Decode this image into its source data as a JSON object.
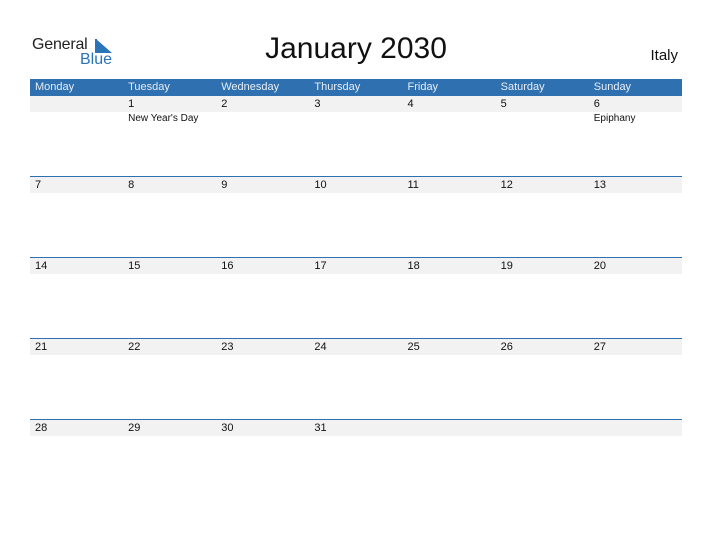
{
  "logo": {
    "text_general": "General",
    "text_blue": "Blue"
  },
  "title": "January 2030",
  "country": "Italy",
  "colors": {
    "accent": "#2e70b0",
    "row_band": "#f2f2f2"
  },
  "weekdays": [
    "Monday",
    "Tuesday",
    "Wednesday",
    "Thursday",
    "Friday",
    "Saturday",
    "Sunday"
  ],
  "weeks": [
    {
      "days": [
        {
          "num": "",
          "holiday": ""
        },
        {
          "num": "1",
          "holiday": "New Year's Day"
        },
        {
          "num": "2",
          "holiday": ""
        },
        {
          "num": "3",
          "holiday": ""
        },
        {
          "num": "4",
          "holiday": ""
        },
        {
          "num": "5",
          "holiday": ""
        },
        {
          "num": "6",
          "holiday": "Epiphany"
        }
      ]
    },
    {
      "days": [
        {
          "num": "7",
          "holiday": ""
        },
        {
          "num": "8",
          "holiday": ""
        },
        {
          "num": "9",
          "holiday": ""
        },
        {
          "num": "10",
          "holiday": ""
        },
        {
          "num": "11",
          "holiday": ""
        },
        {
          "num": "12",
          "holiday": ""
        },
        {
          "num": "13",
          "holiday": ""
        }
      ]
    },
    {
      "days": [
        {
          "num": "14",
          "holiday": ""
        },
        {
          "num": "15",
          "holiday": ""
        },
        {
          "num": "16",
          "holiday": ""
        },
        {
          "num": "17",
          "holiday": ""
        },
        {
          "num": "18",
          "holiday": ""
        },
        {
          "num": "19",
          "holiday": ""
        },
        {
          "num": "20",
          "holiday": ""
        }
      ]
    },
    {
      "days": [
        {
          "num": "21",
          "holiday": ""
        },
        {
          "num": "22",
          "holiday": ""
        },
        {
          "num": "23",
          "holiday": ""
        },
        {
          "num": "24",
          "holiday": ""
        },
        {
          "num": "25",
          "holiday": ""
        },
        {
          "num": "26",
          "holiday": ""
        },
        {
          "num": "27",
          "holiday": ""
        }
      ]
    },
    {
      "days": [
        {
          "num": "28",
          "holiday": ""
        },
        {
          "num": "29",
          "holiday": ""
        },
        {
          "num": "30",
          "holiday": ""
        },
        {
          "num": "31",
          "holiday": ""
        },
        {
          "num": "",
          "holiday": ""
        },
        {
          "num": "",
          "holiday": ""
        },
        {
          "num": "",
          "holiday": ""
        }
      ]
    }
  ]
}
